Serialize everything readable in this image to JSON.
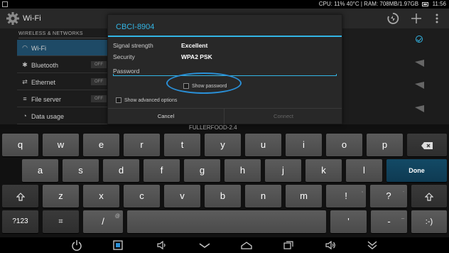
{
  "status_bar": {
    "cpu": "CPU:",
    "cpu_value": "11%",
    "temp": "40°C",
    "ram": "| RAM: 708MB/1.97GB",
    "time": "11:56"
  },
  "action_bar": {
    "title": "Wi-Fi",
    "icons": [
      "gear-icon",
      "wps-icon",
      "add-icon",
      "overflow-menu-icon"
    ]
  },
  "settings": {
    "section_header": "WIRELESS & NETWORKS",
    "items": [
      {
        "label": "Wi-Fi",
        "icon": "wifi-icon",
        "active": true
      },
      {
        "label": "Bluetooth",
        "icon": "bluetooth-icon",
        "toggle": "OFF"
      },
      {
        "label": "Ethernet",
        "icon": "ethernet-icon",
        "toggle": "OFF"
      },
      {
        "label": "File server",
        "icon": "file-server-icon",
        "toggle": "OFF"
      },
      {
        "label": "Data usage",
        "icon": "data-usage-icon"
      }
    ],
    "network_peek": "FULLERFOOD-2.4"
  },
  "dialog": {
    "title": "CBCI-8904",
    "signal_label": "Signal strength",
    "signal_value": "Excellent",
    "security_label": "Security",
    "security_value": "WPA2 PSK",
    "password_label": "Password",
    "password_value": "",
    "show_password_label": "Show password",
    "show_password_checked": false,
    "advanced_label": "Show advanced options",
    "advanced_checked": false,
    "cancel_label": "Cancel",
    "connect_label": "Connect",
    "accent_color": "#33b5e5"
  },
  "keyboard": {
    "row1": [
      "q",
      "w",
      "e",
      "r",
      "t",
      "y",
      "u",
      "i",
      "o",
      "p"
    ],
    "row2": [
      "a",
      "s",
      "d",
      "f",
      "g",
      "h",
      "j",
      "k",
      "l"
    ],
    "row3": [
      "z",
      "x",
      "c",
      "v",
      "b",
      "n",
      "m",
      "!",
      "?"
    ],
    "row3_hints": {
      "m": "",
      "!": ",",
      "?": "."
    },
    "done_label": "Done",
    "symbols_label": "?123",
    "settings_key": "⌗",
    "slash_key": "/",
    "slash_hint": "@",
    "apostrophe_key": "'",
    "dash_key": "-",
    "dash_hint": "_",
    "smiley_key": ":-)",
    "backspace_icon": "backspace-icon",
    "shift_icon": "shift-icon"
  },
  "nav_bar": {
    "icons": [
      "power-icon",
      "screenshot-icon",
      "volume-down-icon",
      "back-icon",
      "home-icon",
      "recent-apps-icon",
      "volume-up-icon",
      "hide-keyboard-icon"
    ]
  }
}
